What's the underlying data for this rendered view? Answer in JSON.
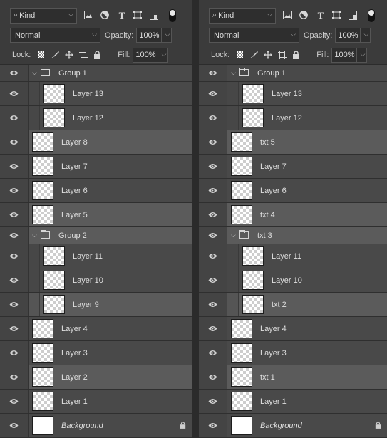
{
  "toolbar": {
    "kind_label": "Kind",
    "blend_mode": "Normal",
    "opacity_label": "Opacity:",
    "opacity_value": "100%",
    "lock_label": "Lock:",
    "fill_label": "Fill:",
    "fill_value": "100%"
  },
  "icons": {
    "filter": [
      "image-filter-icon",
      "adjustment-filter-icon",
      "type-filter-icon",
      "shape-filter-icon",
      "smart-object-filter-icon"
    ],
    "lock": [
      "lock-transparent-pixels-icon",
      "lock-image-pixels-icon",
      "lock-position-icon",
      "lock-artboard-icon",
      "lock-all-icon"
    ]
  },
  "left_layers": [
    {
      "name": "Group 1",
      "type": "group",
      "indent": 0,
      "selected": false
    },
    {
      "name": "Layer 13",
      "type": "layer",
      "indent": 1,
      "selected": false
    },
    {
      "name": "Layer 12",
      "type": "layer",
      "indent": 1,
      "selected": false
    },
    {
      "name": "Layer 8",
      "type": "layer",
      "indent": 0,
      "selected": true
    },
    {
      "name": "Layer 7",
      "type": "layer",
      "indent": 0,
      "selected": false
    },
    {
      "name": "Layer 6",
      "type": "layer",
      "indent": 0,
      "selected": false
    },
    {
      "name": "Layer 5",
      "type": "layer",
      "indent": 0,
      "selected": true
    },
    {
      "name": "Group 2",
      "type": "group",
      "indent": 0,
      "selected": true
    },
    {
      "name": "Layer 11",
      "type": "layer",
      "indent": 1,
      "selected": false
    },
    {
      "name": "Layer 10",
      "type": "layer",
      "indent": 1,
      "selected": false
    },
    {
      "name": "Layer 9",
      "type": "layer",
      "indent": 1,
      "selected": true
    },
    {
      "name": "Layer 4",
      "type": "layer",
      "indent": 0,
      "selected": false
    },
    {
      "name": "Layer 3",
      "type": "layer",
      "indent": 0,
      "selected": false
    },
    {
      "name": "Layer 2",
      "type": "layer",
      "indent": 0,
      "selected": true
    },
    {
      "name": "Layer 1",
      "type": "layer",
      "indent": 0,
      "selected": false
    },
    {
      "name": "Background",
      "type": "background",
      "indent": 0,
      "selected": false
    }
  ],
  "right_layers": [
    {
      "name": "Group 1",
      "type": "group",
      "indent": 0,
      "selected": false
    },
    {
      "name": "Layer 13",
      "type": "layer",
      "indent": 1,
      "selected": false
    },
    {
      "name": "Layer 12",
      "type": "layer",
      "indent": 1,
      "selected": false
    },
    {
      "name": "txt 5",
      "type": "layer",
      "indent": 0,
      "selected": true
    },
    {
      "name": "Layer 7",
      "type": "layer",
      "indent": 0,
      "selected": false
    },
    {
      "name": "Layer 6",
      "type": "layer",
      "indent": 0,
      "selected": false
    },
    {
      "name": "txt 4",
      "type": "layer",
      "indent": 0,
      "selected": true
    },
    {
      "name": "txt 3",
      "type": "group",
      "indent": 0,
      "selected": true
    },
    {
      "name": "Layer 11",
      "type": "layer",
      "indent": 1,
      "selected": false
    },
    {
      "name": "Layer 10",
      "type": "layer",
      "indent": 1,
      "selected": false
    },
    {
      "name": "txt 2",
      "type": "layer",
      "indent": 1,
      "selected": true
    },
    {
      "name": "Layer 4",
      "type": "layer",
      "indent": 0,
      "selected": false
    },
    {
      "name": "Layer 3",
      "type": "layer",
      "indent": 0,
      "selected": false
    },
    {
      "name": "txt 1",
      "type": "layer",
      "indent": 0,
      "selected": true
    },
    {
      "name": "Layer 1",
      "type": "layer",
      "indent": 0,
      "selected": false
    },
    {
      "name": "Background",
      "type": "background",
      "indent": 0,
      "selected": false
    }
  ]
}
